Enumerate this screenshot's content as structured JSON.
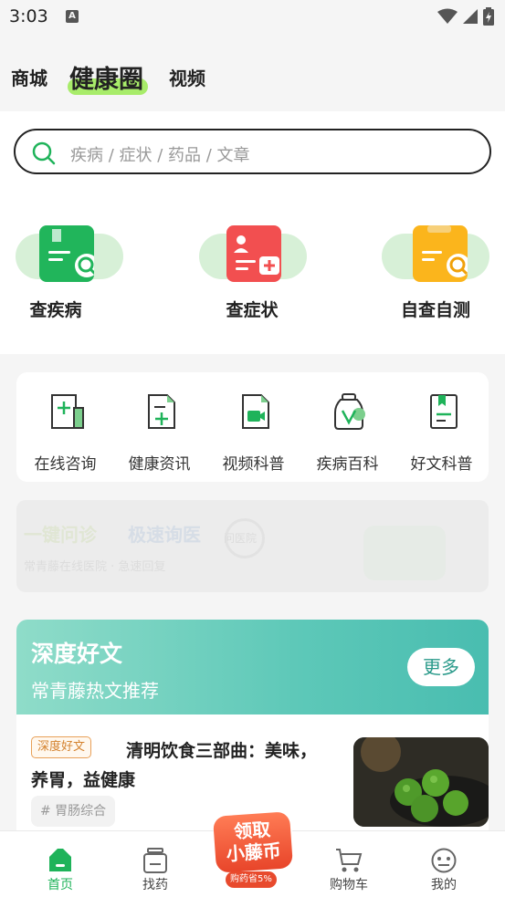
{
  "status_bar": {
    "time": "3:03",
    "notification_glyph": "A"
  },
  "header": {
    "tabs": [
      {
        "label": "商城"
      },
      {
        "label": "健康圈"
      },
      {
        "label": "视频"
      }
    ]
  },
  "search": {
    "placeholder": "疾病 / 症状 / 药品 / 文章"
  },
  "quick_actions": [
    {
      "label": "查疾病",
      "icon": "disease-book-icon",
      "color": "#21b55b"
    },
    {
      "label": "查症状",
      "icon": "symptom-doctor-icon",
      "color": "#f24f50"
    },
    {
      "label": "自查自测",
      "icon": "self-test-icon",
      "color": "#fbb51c"
    }
  ],
  "services": [
    {
      "label": "在线咨询",
      "icon": "consult-icon"
    },
    {
      "label": "健康资讯",
      "icon": "health-news-icon"
    },
    {
      "label": "视频科普",
      "icon": "video-icon"
    },
    {
      "label": "疾病百科",
      "icon": "disease-wiki-icon"
    },
    {
      "label": "好文科普",
      "icon": "article-icon"
    }
  ],
  "banner": {
    "headline_left": "一键问诊",
    "headline_right": "极速询医",
    "subtitle": "常青藤在线医院 · 急速回复",
    "badge": "问医院"
  },
  "articles": {
    "title": "深度好文",
    "subtitle": "常青藤热文推荐",
    "more_label": "更多",
    "items": [
      {
        "tag": "深度好文",
        "title": "清明饮食三部曲：美味，养胃，益健康",
        "topic": "# 胃肠综合"
      }
    ]
  },
  "promo": {
    "line1": "领取",
    "line2": "小藤币",
    "sub": "购药省5%"
  },
  "bottom_nav": [
    {
      "label": "首页",
      "icon": "home-icon",
      "active": true
    },
    {
      "label": "找药",
      "icon": "medicine-icon",
      "active": false
    },
    {
      "label": "购物车",
      "icon": "cart-icon",
      "active": false
    },
    {
      "label": "我的",
      "icon": "profile-icon",
      "active": false
    }
  ],
  "colors": {
    "accent": "#1fb35a",
    "tab_highlight": "#a8ec6a",
    "article_header": "#5dc8b8"
  }
}
